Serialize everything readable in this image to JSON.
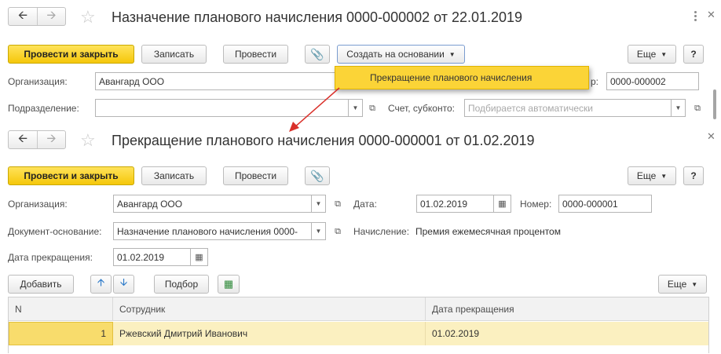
{
  "doc1": {
    "title": "Назначение планового начисления 0000-000002 от 22.01.2019",
    "toolbar": {
      "post_close": "Провести и закрыть",
      "save": "Записать",
      "post": "Провести",
      "create_basis": "Создать на основании",
      "more": "Еще",
      "help": "?"
    },
    "org_label": "Организация:",
    "org_value": "Авангард ООО",
    "number_label": "р:",
    "number_value": "0000-000002",
    "dept_label": "Подразделение:",
    "dept_value": "",
    "account_label": "Счет, субконто:",
    "account_placeholder": "Подбирается автоматически",
    "dropdown_item": "Прекращение планового начисления"
  },
  "doc2": {
    "title": "Прекращение планового начисления 0000-000001 от 01.02.2019",
    "toolbar": {
      "post_close": "Провести и закрыть",
      "save": "Записать",
      "post": "Провести",
      "more": "Еще",
      "help": "?"
    },
    "org_label": "Организация:",
    "org_value": "Авангард ООО",
    "date_label": "Дата:",
    "date_value": "01.02.2019",
    "number_label": "Номер:",
    "number_value": "0000-000001",
    "basis_label": "Документ-основание:",
    "basis_value": "Назначение планового начисления 0000-",
    "accrual_label": "Начисление:",
    "accrual_value": "Премия ежемесячная процентом",
    "stop_date_label": "Дата прекращения:",
    "stop_date_value": "01.02.2019",
    "table_toolbar": {
      "add": "Добавить",
      "select": "Подбор",
      "more": "Еще"
    },
    "table": {
      "columns": [
        "N",
        "Сотрудник",
        "Дата прекращения"
      ],
      "rows": [
        {
          "n": "1",
          "employee": "Ржевский Дмитрий Иванович",
          "stop_date": "01.02.2019"
        }
      ]
    }
  },
  "icons": {
    "back": "arrow-left-icon",
    "forward": "arrow-right-icon",
    "star": "star-icon",
    "paperclip": "paperclip-icon",
    "calendar": "calendar-icon",
    "open": "open-icon"
  },
  "colors": {
    "primary_button": "#f5c70a",
    "dropdown_highlight": "#fbd437",
    "selected_row": "#fbf0c0",
    "arrow": "#d9302a"
  }
}
